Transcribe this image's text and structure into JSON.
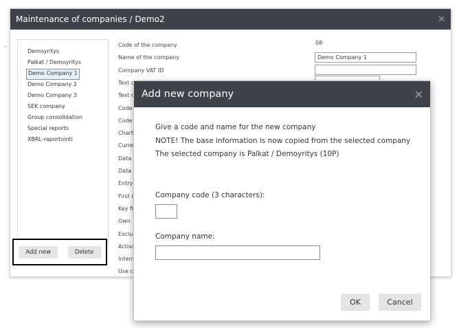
{
  "main_window": {
    "title": "Maintenance of companies / Demo2"
  },
  "side_mark": "–",
  "company_list": [
    "Demoyritys",
    "Palkat / Demoyritys",
    "Demo Company 1",
    "Demo Company 2",
    "Demo Company 3",
    "SEK company",
    "Group consolidation",
    "Special reports",
    "XBRL-raportointi"
  ],
  "selected_company_index": 2,
  "list_buttons": {
    "add_new": "Add new",
    "delete": "Delete"
  },
  "fields": [
    "Code of the company",
    "Name of the company",
    "Company VAT ID",
    "Text of BRCTH",
    "Text o",
    "Code",
    "Code",
    "Chart",
    "Curre",
    "Data",
    "Data",
    "Entry",
    "First r",
    "Key fi",
    "Own",
    "Exclu",
    "Activa",
    "Intern",
    "Use cr"
  ],
  "company_code_value": "08",
  "company_name_value": "Demo Company 1",
  "company_vat_value": "",
  "dialog": {
    "title": "Add new company",
    "info": [
      "Give a code and name for the new company",
      "NOTE! The base information is now copied from the selected company",
      "The selected company is Palkat / Demoyritys (10P)"
    ],
    "code_label": "Company code (3 characters):",
    "code_value": "",
    "name_label": "Company name:",
    "name_value": "",
    "ok": "OK",
    "cancel": "Cancel"
  }
}
